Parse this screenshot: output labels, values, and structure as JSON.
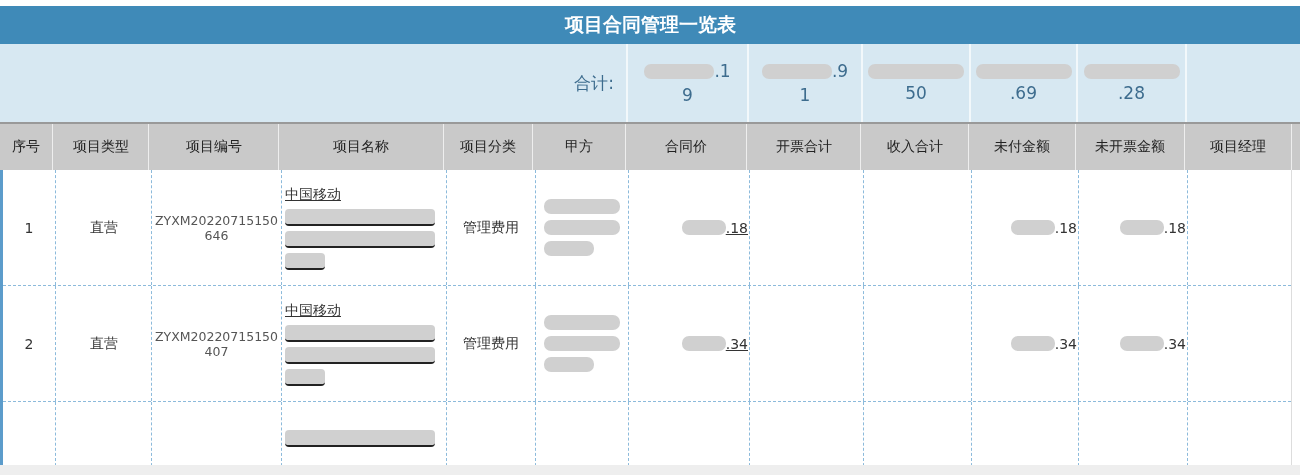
{
  "title": "项目合同管理一览表",
  "totals": {
    "label": "合计:",
    "cells": [
      {
        "line1": ".1",
        "line2": "9"
      },
      {
        "line1": ".9",
        "line2": "1"
      },
      {
        "line2": "50"
      },
      {
        "line2": ".69"
      },
      {
        "line2": ".28"
      }
    ]
  },
  "columns": [
    "序号",
    "项目类型",
    "项目编号",
    "项目名称",
    "项目分类",
    "甲方",
    "合同价",
    "开票合计",
    "收入合计",
    "未付金额",
    "未开票金额",
    "项目经理"
  ],
  "rows": [
    {
      "kind": "full",
      "index": "1",
      "type": "直营",
      "code": "ZYXM20220715150646",
      "name": "中国移动",
      "category": "管理费用",
      "contract_price": ".18",
      "unpaid": ".18",
      "uninvoiced": ".18"
    },
    {
      "kind": "full",
      "index": "2",
      "type": "直营",
      "code": "ZYXM20220715150407",
      "name": "中国移动",
      "category": "管理费用",
      "contract_price": ".34",
      "unpaid": ".34",
      "uninvoiced": ".34"
    },
    {
      "kind": "partial"
    }
  ]
}
